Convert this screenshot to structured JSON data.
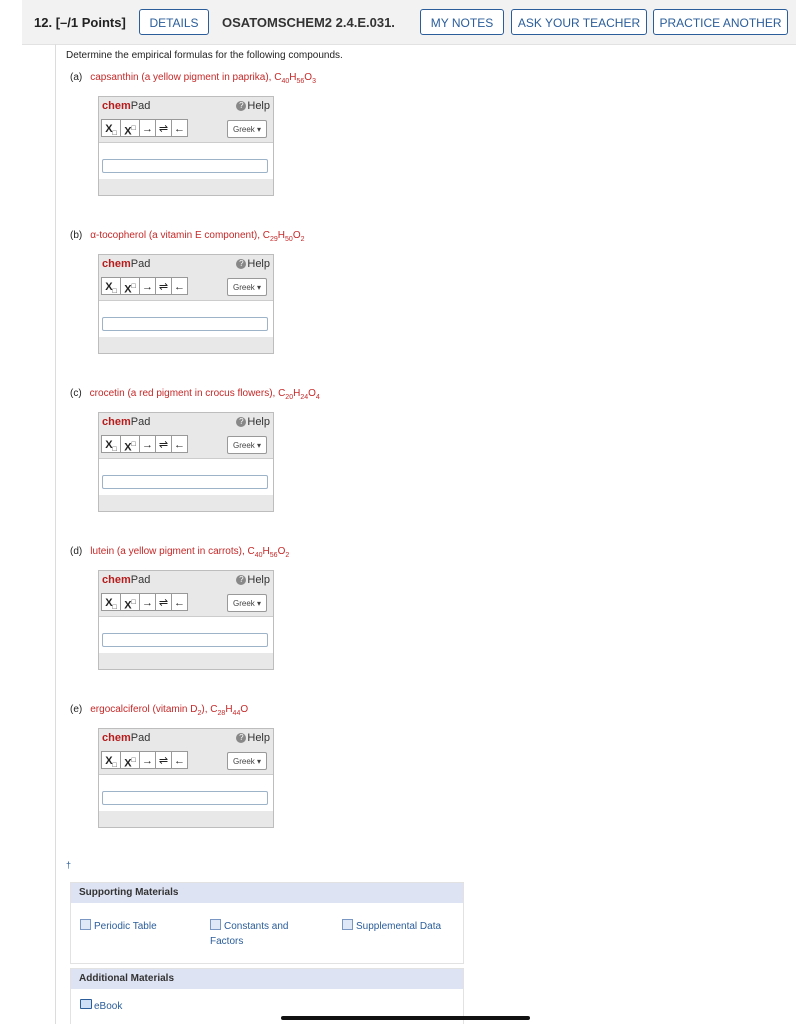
{
  "header": {
    "question_number": "12.",
    "points": "[–/1 Points]",
    "details_label": "DETAILS",
    "question_code": "OSATOMSCHEM2 2.4.E.031.",
    "my_notes_label": "MY NOTES",
    "ask_teacher_label": "ASK YOUR TEACHER",
    "practice_label": "PRACTICE ANOTHER"
  },
  "intro": "Determine the empirical formulas for the following compounds.",
  "parts": [
    {
      "label": "(a)",
      "text": "capsanthin (a yellow pigment in paprika), C40H56O3"
    },
    {
      "label": "(b)",
      "text": "α-tocopherol (a vitamin E component), C29H50O2"
    },
    {
      "label": "(c)",
      "text": "crocetin (a red pigment in crocus flowers), C20H24O4"
    },
    {
      "label": "(d)",
      "text": "lutein (a yellow pigment in carrots), C40H56O2"
    },
    {
      "label": "(e)",
      "text": "ergocalciferol (vitamin D2), C28H44O"
    }
  ],
  "chempad": {
    "title_chem": "chem",
    "title_pad": "Pad",
    "help_label": "Help",
    "sub_label": "X",
    "sup_label": "X",
    "arrow_right": "→",
    "arrow_equilibrium": "⇌",
    "arrow_left": "←",
    "greek_label": "Greek ▾"
  },
  "dagger": "†",
  "supporting": {
    "title": "Supporting Materials",
    "items": [
      "Periodic Table",
      "Constants and Factors",
      "Supplemental Data"
    ]
  },
  "additional": {
    "title": "Additional Materials",
    "items": [
      "eBook"
    ]
  }
}
